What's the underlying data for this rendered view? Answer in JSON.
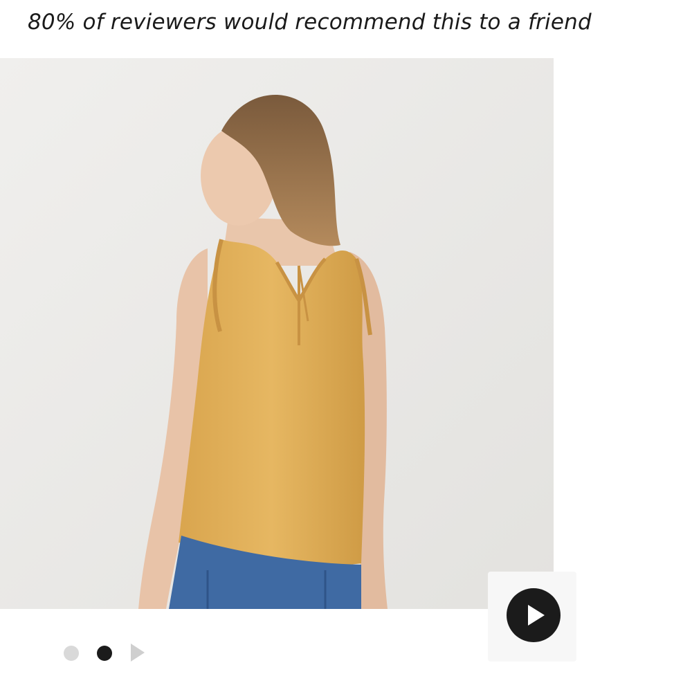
{
  "review": {
    "recommend_text": "80% of reviewers would recommend this to a friend"
  },
  "gallery": {
    "image_description_icon": "product-photo",
    "pagination": {
      "total_visible_dots": 2,
      "active_index": 1
    },
    "video": {
      "icon": "play-icon"
    }
  },
  "colors": {
    "top_color": "#E2B25E",
    "background": "#ECECEA",
    "accent_dark": "#1B1B1B"
  }
}
